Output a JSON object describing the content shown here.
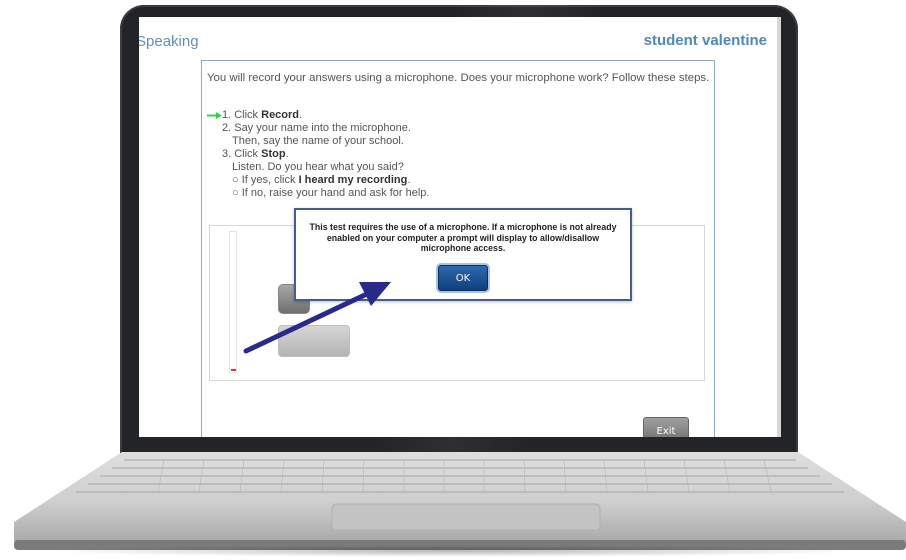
{
  "header": {
    "app_title": "Speaking",
    "user_name": "student valentine"
  },
  "instructions": {
    "intro": "You will record your answers using a microphone. Does your microphone work? Follow these steps.",
    "step1_prefix": "1. Click ",
    "step1_bold": "Record",
    "step1_suffix": ".",
    "step2_line1": "2. Say your name into the microphone.",
    "step2_line2": "Then, say the name of your school.",
    "step3_prefix": "3. Click ",
    "step3_bold": "Stop",
    "step3_suffix": ".",
    "step3_line2": "Listen. Do you hear what you said?",
    "bullet1_prefix": "If yes, click ",
    "bullet1_bold": "I heard my recording",
    "bullet1_suffix": ".",
    "bullet2": "If no, raise your hand and ask for help.",
    "bullet_glyph": "○"
  },
  "dialog": {
    "message": "This test requires the use of a microphone. If a microphone is not already enabled on your computer a prompt will display to allow/disallow microphone access.",
    "ok_label": "OK"
  },
  "footer": {
    "exit_label": "Exit"
  },
  "colors": {
    "title_blue": "#5f8fb8",
    "accent_blue": "#4f88b8",
    "ok_blue": "#1a4f8f",
    "arrow_navy": "#2a2a8a",
    "indicator_green": "#38d04a"
  },
  "icons": {
    "current_step_indicator": "green-arrow-icon",
    "annotation": "pointer-arrow-icon"
  }
}
